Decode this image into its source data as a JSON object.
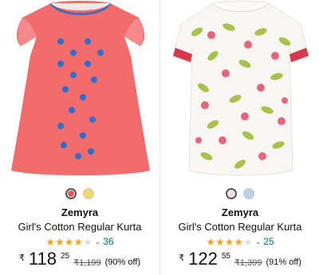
{
  "products": [
    {
      "brand": "Zemyra",
      "title": "Girl's Cotton Regular Kurta",
      "rating_stars": 3.5,
      "rating_count": "36",
      "price_currency": "₹",
      "price_whole": "118",
      "price_fraction": "25",
      "mrp": "₹1,199",
      "discount": "(90% off)",
      "swatches": [
        "#e4585b",
        "#f5d766"
      ],
      "image_colors": {
        "dress": "#f26c6c",
        "trim": "#4a68b3",
        "embroidery": "#2a6fd0"
      }
    },
    {
      "brand": "Zemyra",
      "title": "Girl's Cotton Regular Kurta",
      "rating_stars": 4,
      "rating_count": "25",
      "price_currency": "₹",
      "price_whole": "122",
      "price_fraction": "55",
      "mrp": "₹1,399",
      "discount": "(91% off)",
      "swatches": [
        "#f0dede",
        "#b9d3ec"
      ],
      "image_colors": {
        "base": "#f7f6f2",
        "leaf": "#a8c24a",
        "flower": "#e8647a",
        "cuff": "#d63a4a"
      }
    }
  ],
  "colors": {
    "star": "#f6a41a",
    "link": "#007185"
  }
}
